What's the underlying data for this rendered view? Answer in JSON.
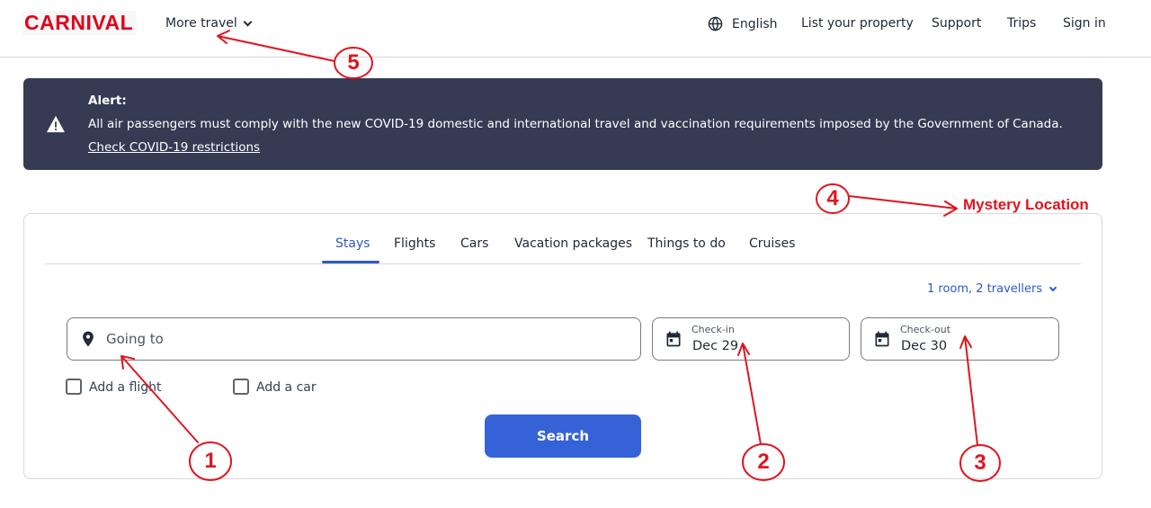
{
  "header": {
    "logo_text": "CARNIVAL",
    "more_travel": "More travel",
    "language": "English",
    "list_property": "List your property",
    "support": "Support",
    "trips": "Trips",
    "sign_in": "Sign in"
  },
  "alert": {
    "title": "Alert:",
    "body": "All air passengers must comply with the new COVID-19 domestic and international travel and vaccination requirements imposed by the Government of Canada.",
    "link": "Check COVID-19 restrictions",
    "background": "#343b53"
  },
  "search": {
    "tabs": [
      "Stays",
      "Flights",
      "Cars",
      "Vacation packages",
      "Things to do",
      "Cruises"
    ],
    "active_tab": "Stays",
    "travellers": "1 room, 2 travellers",
    "going_to_placeholder": "Going to",
    "checkin_label": "Check-in",
    "checkin_value": "Dec 29",
    "checkout_label": "Check-out",
    "checkout_value": "Dec 30",
    "add_flight": "Add a flight",
    "add_car": "Add a car",
    "search_button": "Search",
    "accent_color": "#3662d8"
  },
  "annotations": {
    "mystery_label": "Mystery Location",
    "numbers": [
      "1",
      "2",
      "3",
      "4",
      "5"
    ],
    "color": "#e0141e"
  }
}
